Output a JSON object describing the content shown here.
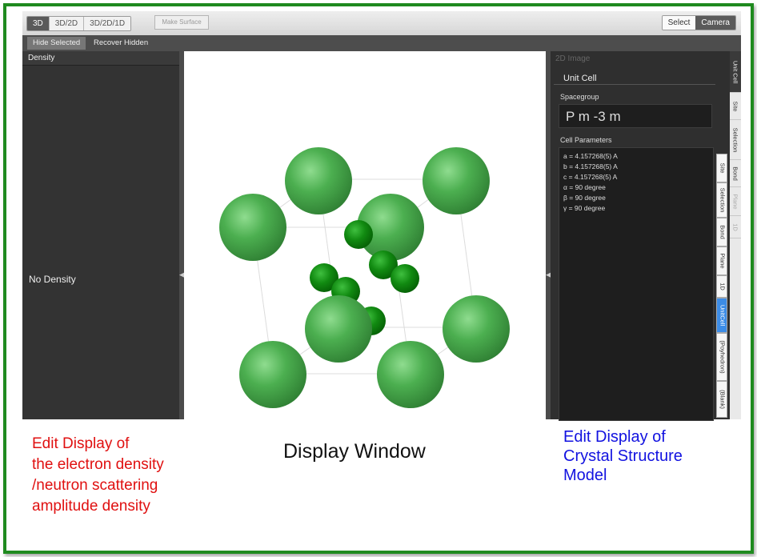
{
  "toolbar": {
    "view_modes": [
      "3D",
      "3D/2D",
      "3D/2D/1D"
    ],
    "active_view_mode": "3D",
    "make_surface_label": "Make Surface",
    "interaction_modes": [
      "Select",
      "Camera"
    ],
    "active_interaction_mode": "Camera"
  },
  "subtoolbar": {
    "hide_selected_label": "Hide Selected",
    "recover_hidden_label": "Recover Hidden"
  },
  "left_panel": {
    "header": "Density",
    "status": "No Density"
  },
  "right_panel": {
    "image_label": "2D Image",
    "section_title": "Unit Cell",
    "spacegroup_label": "Spacegroup",
    "spacegroup_value": "P m -3 m",
    "cell_params_label": "Cell Parameters",
    "cell_params": [
      "a = 4.157268(5) A",
      "b = 4.157268(5) A",
      "c = 4.157268(5) A",
      "α = 90 degree",
      "β = 90 degree",
      "γ = 90 degree"
    ],
    "inner_tabs": [
      "Site",
      "Selection",
      "Bond",
      "Plane",
      "1D",
      "UnitCell",
      "(Poyhedron)",
      "(Blank)"
    ],
    "active_inner_tab": "UnitCell",
    "outer_tabs": [
      "Unit Cell",
      "Site",
      "Selection",
      "Bond",
      "Plane",
      "1D"
    ]
  },
  "annotations": {
    "left": [
      "Edit Display of",
      "the electron density",
      "/neutron scattering",
      "amplitude density"
    ],
    "center": "Display Window",
    "right": [
      "Edit Display of",
      "Crystal Structure",
      "Model"
    ]
  },
  "colors": {
    "frame_border": "#1f8a1f",
    "atom_large": "#4caf50",
    "atom_small": "#118a11",
    "annotation_red": "#e01010",
    "annotation_blue": "#1212e0",
    "tab_active": "#3c8ce6"
  }
}
